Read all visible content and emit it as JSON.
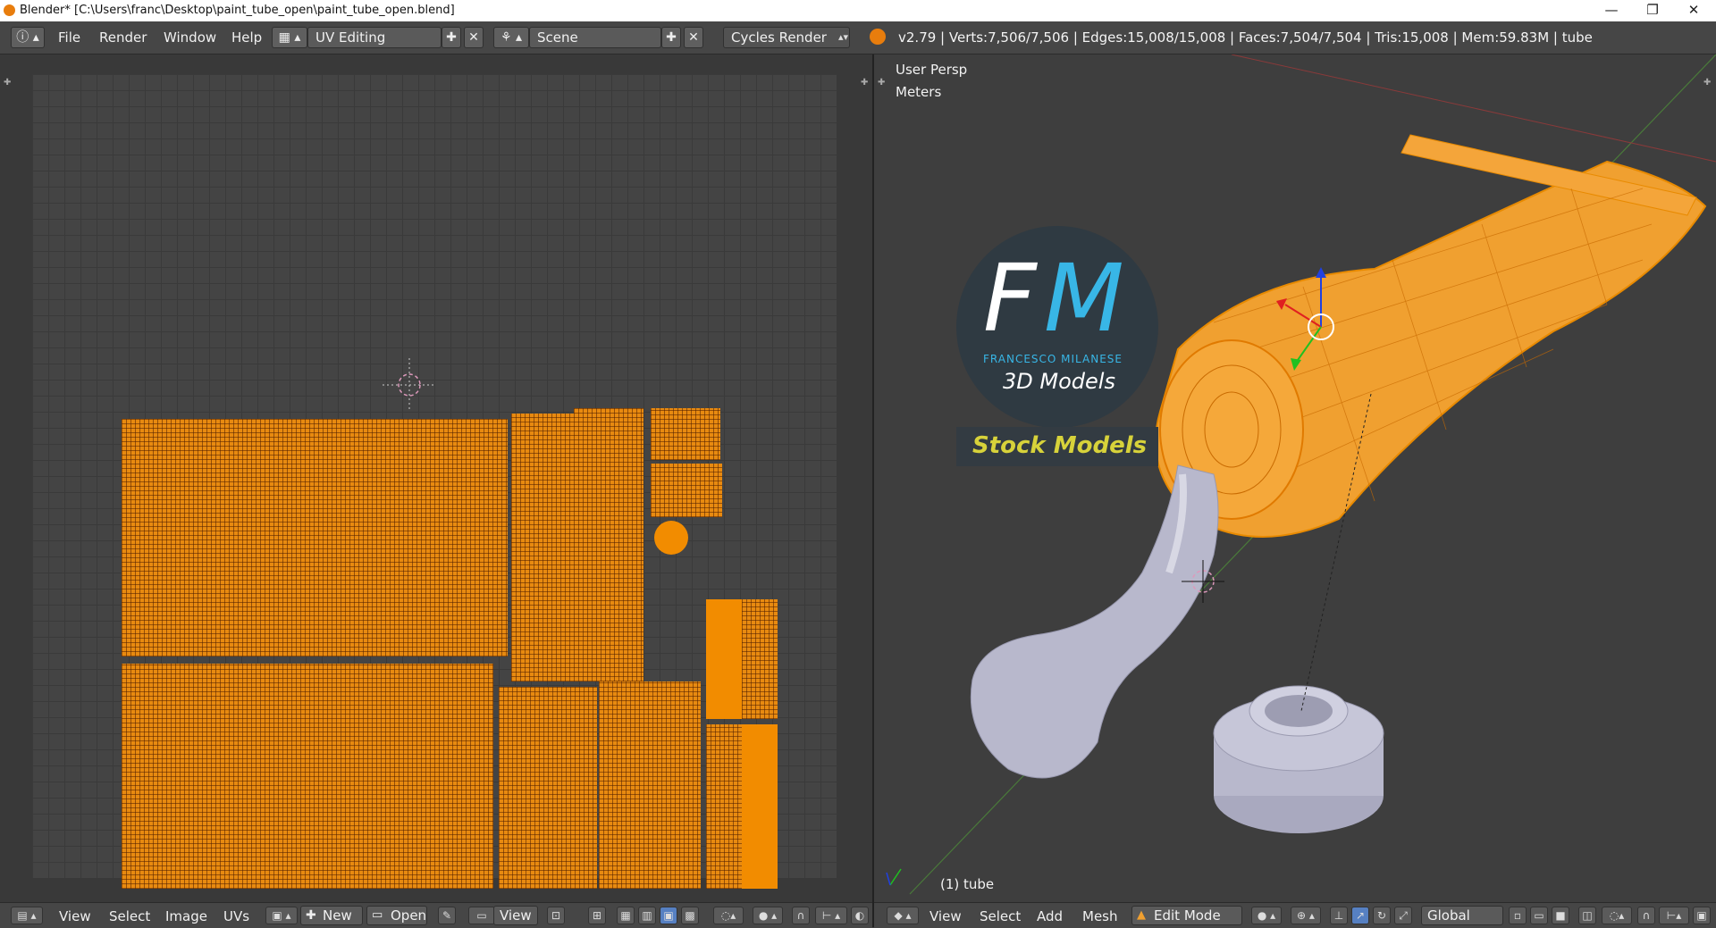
{
  "window": {
    "title": "Blender* [C:\\Users\\franc\\Desktop\\paint_tube_open\\paint_tube_open.blend]",
    "minimize": "—",
    "restore": "❐",
    "close": "✕"
  },
  "menubar": {
    "items": [
      "File",
      "Render",
      "Window",
      "Help"
    ],
    "layout_value": "UV Editing",
    "scene_value": "Scene",
    "engine_value": "Cycles Render",
    "stats": "v2.79 | Verts:7,506/7,506 | Edges:15,008/15,008 | Faces:7,504/7,504 | Tris:15,008 | Mem:59.83M | tube"
  },
  "uv_editor": {
    "menu": [
      "View",
      "Select",
      "Image",
      "UVs"
    ],
    "new_label": "New",
    "open_label": "Open",
    "view_label": "View"
  },
  "viewport": {
    "view_name": "User Persp",
    "units": "Meters",
    "object_label": "(1) tube",
    "logo_letters_f": "F",
    "logo_letters_m": "M",
    "logo_name": "FRANCESCO MILANESE",
    "logo_sub": "3D Models",
    "banner": "Stock Models",
    "menu": [
      "View",
      "Select",
      "Add",
      "Mesh"
    ],
    "mode_label": "Edit Mode",
    "orientation_label": "Global"
  },
  "colors": {
    "accent_orange": "#f28c00",
    "logo_blue": "#38b6e6",
    "banner_yellow": "#d7d23a"
  }
}
